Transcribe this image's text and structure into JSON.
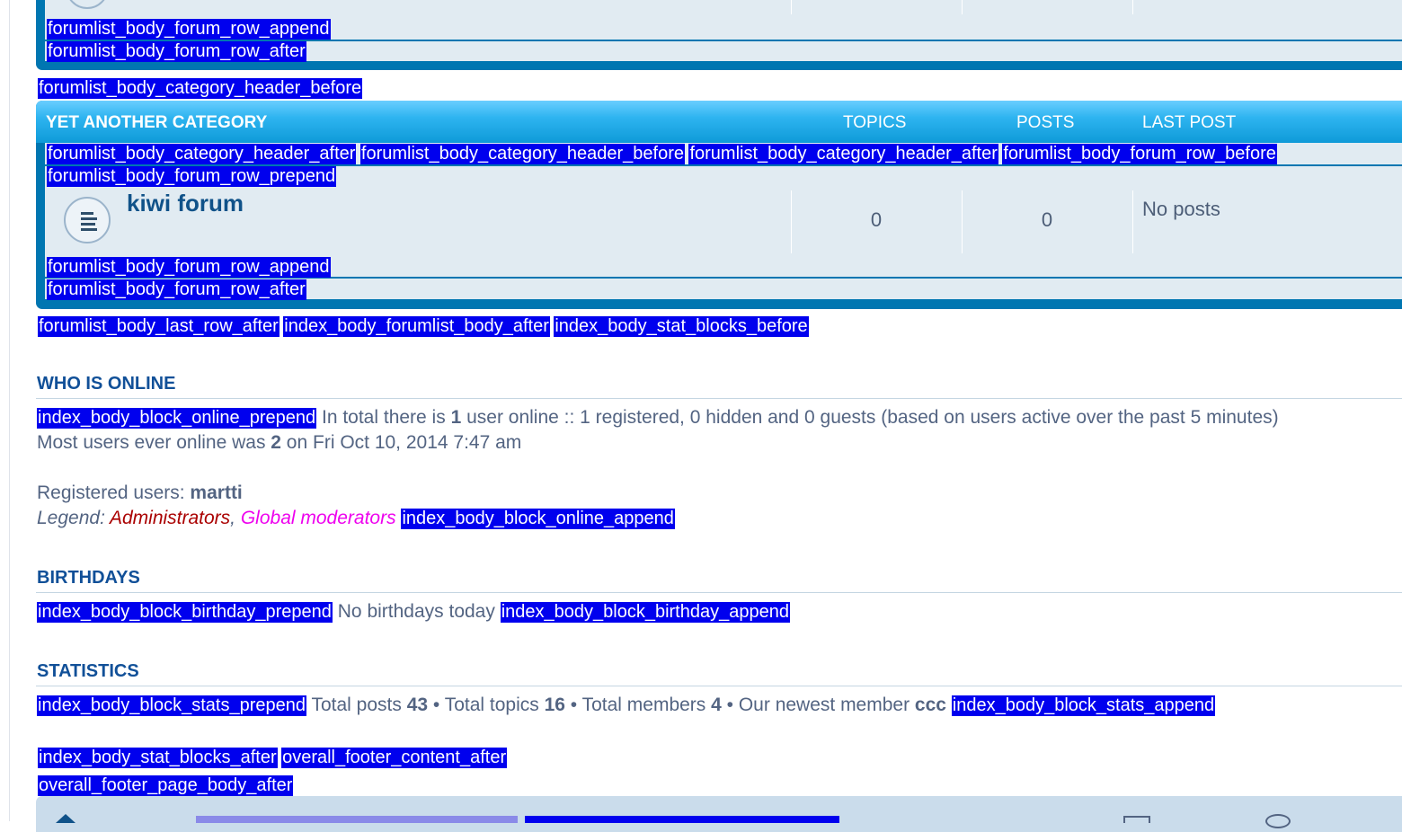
{
  "category_top": {
    "events": {
      "row_append": "forumlist_body_forum_row_append",
      "row_after": "forumlist_body_forum_row_after",
      "header_before": "forumlist_body_category_header_before"
    }
  },
  "category": {
    "title": "YET ANOTHER CATEGORY",
    "col_topics": "TOPICS",
    "col_posts": "POSTS",
    "col_last_post": "LAST POST",
    "header_events": [
      "forumlist_body_category_header_after",
      "forumlist_body_category_header_before",
      "forumlist_body_category_header_after",
      "forumlist_body_forum_row_before"
    ],
    "row_prepend": "forumlist_body_forum_row_prepend",
    "forum": {
      "name": "kiwi forum",
      "icon": "forum-read-icon",
      "topics": "0",
      "posts": "0",
      "last_post": "No posts"
    },
    "row_append": "forumlist_body_forum_row_append",
    "row_after": "forumlist_body_forum_row_after"
  },
  "after_events": [
    "forumlist_body_last_row_after",
    "index_body_forumlist_body_after",
    "index_body_stat_blocks_before"
  ],
  "online": {
    "title": "WHO IS ONLINE",
    "prepend": "index_body_block_online_prepend",
    "line1_a": "In total there is ",
    "line1_count": "1",
    "line1_b": " user online :: 1 registered, 0 hidden and 0 guests (based on users active over the past 5 minutes)",
    "line2_a": "Most users ever online was ",
    "line2_count": "2",
    "line2_b": " on Fri Oct 10, 2014 7:47 am",
    "registered_label": "Registered users: ",
    "registered_user": "martti",
    "legend_label": "Legend: ",
    "legend_admins": "Administrators",
    "legend_sep": ", ",
    "legend_gmods": "Global moderators",
    "append": "index_body_block_online_append"
  },
  "birthdays": {
    "title": "BIRTHDAYS",
    "prepend": "index_body_block_birthday_prepend",
    "text": "No birthdays today",
    "append": "index_body_block_birthday_append"
  },
  "statistics": {
    "title": "STATISTICS",
    "prepend": "index_body_block_stats_prepend",
    "posts_label": "Total posts ",
    "posts": "43",
    "topics_label": " • Total topics ",
    "topics": "16",
    "members_label": " • Total members ",
    "members": "4",
    "newest_label": " • Our newest member ",
    "newest": "ccc",
    "append": "index_body_block_stats_append"
  },
  "footer_events": {
    "stat_blocks_after": "index_body_stat_blocks_after",
    "footer_content_after": "overall_footer_content_after",
    "page_body_after": "overall_footer_page_body_after"
  },
  "colors": {
    "event_bg": "#0000ee",
    "category_band": "#0076b1",
    "row_bg": "#e1ebf2",
    "section_title": "#115098",
    "admin": "#aa0000",
    "global_moderator": "#ee00ee"
  }
}
